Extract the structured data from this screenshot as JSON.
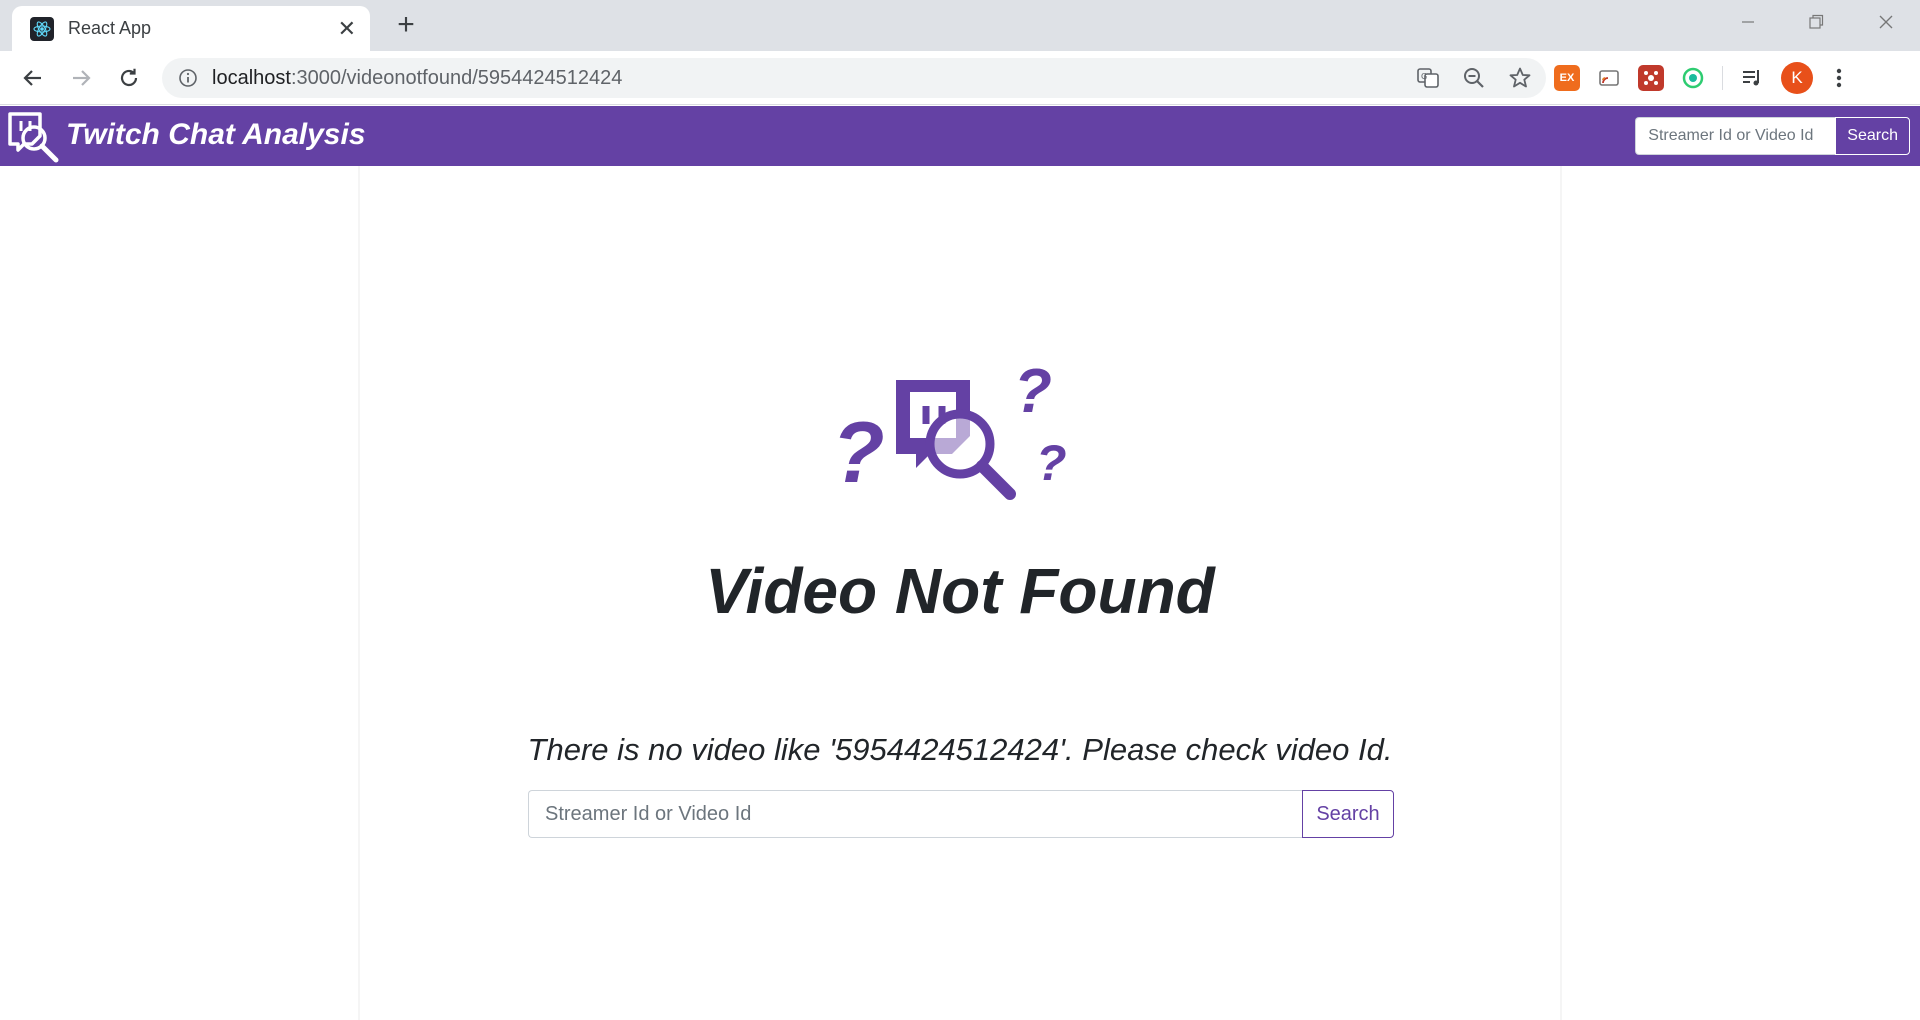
{
  "browser": {
    "tab_title": "React App",
    "tab_favicon": "react-icon",
    "url_host": "localhost",
    "url_path": ":3000/videonotfound/5954424512424",
    "extensions": [
      "translate-icon",
      "zoom-out-icon",
      "star-icon",
      "ex-extension",
      "cast-extension",
      "puzzle-extension",
      "circle-extension",
      "playlist-icon"
    ],
    "ext_ex_label": "EX",
    "profile_initial": "K",
    "profile_color": "#e8501a"
  },
  "navbar": {
    "brand": "Twitch Chat Analysis",
    "search_placeholder": "Streamer Id or Video Id",
    "search_button": "Search",
    "color": "#6441a4"
  },
  "main": {
    "title": "Video Not Found",
    "message": "There is no video like '5954424512424'. Please check video Id.",
    "search_placeholder": "Streamer Id or Video Id",
    "search_button": "Search"
  }
}
